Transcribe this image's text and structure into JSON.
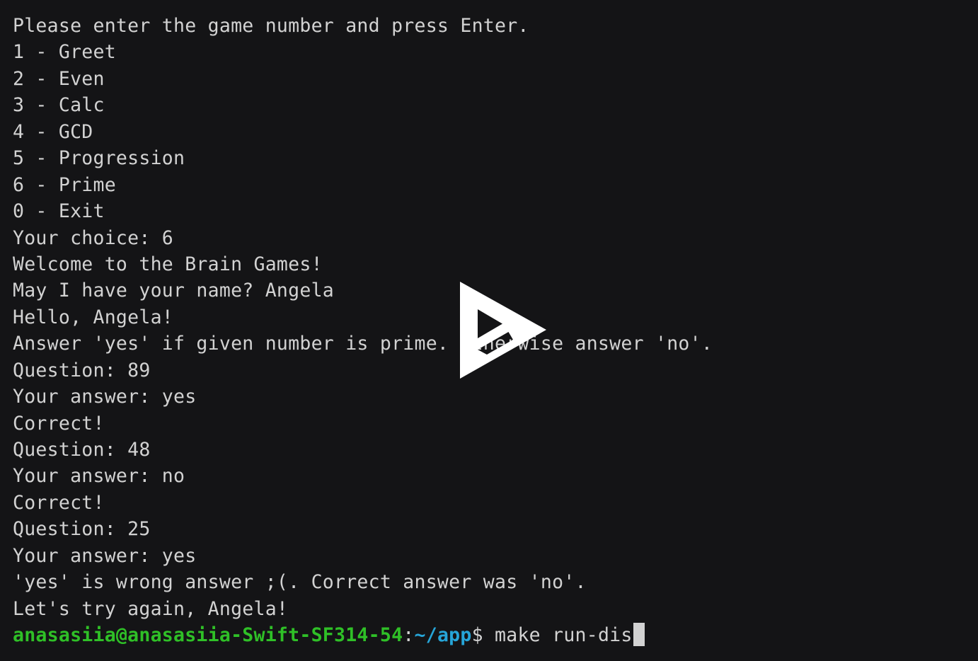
{
  "terminal": {
    "background_color": "#141416",
    "foreground_color": "#d2d2d2",
    "prompt_user_color": "#2fc027",
    "prompt_path_color": "#26a5d8",
    "cursor_color": "#d2d2d2",
    "lines": [
      {
        "text": "Please enter the game number and press Enter."
      },
      {
        "text": "1 - Greet"
      },
      {
        "text": "2 - Even"
      },
      {
        "text": "3 - Calc"
      },
      {
        "text": "4 - GCD"
      },
      {
        "text": "5 - Progression"
      },
      {
        "text": "6 - Prime"
      },
      {
        "text": "0 - Exit"
      },
      {
        "text": "Your choice: 6"
      },
      {
        "text": "Welcome to the Brain Games!"
      },
      {
        "text": "May I have your name? Angela"
      },
      {
        "text": "Hello, Angela!"
      },
      {
        "text": "Answer 'yes' if given number is prime. Otherwise answer 'no'."
      },
      {
        "text": "Question: 89"
      },
      {
        "text": "Your answer: yes"
      },
      {
        "text": "Correct!"
      },
      {
        "text": "Question: 48"
      },
      {
        "text": "Your answer: no"
      },
      {
        "text": "Correct!"
      },
      {
        "text": "Question: 25"
      },
      {
        "text": "Your answer: yes"
      },
      {
        "text": "'yes' is wrong answer ;(. Correct answer was 'no'."
      },
      {
        "text": "Let's try again, Angela!"
      }
    ],
    "prompt": {
      "user_host": "anasasiia@anasasiia-Swift-SF314-54",
      "colon": ":",
      "path": "~/app",
      "symbol": "$ ",
      "command": "make run-dis"
    }
  },
  "overlay": {
    "play_button_label": "play-button",
    "play_button_color": "#ffffff"
  }
}
